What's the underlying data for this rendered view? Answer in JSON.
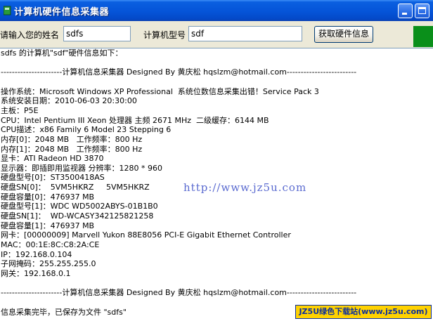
{
  "window": {
    "title": "计算机硬件信息采集器"
  },
  "form": {
    "name_label": "请输入您的姓名",
    "name_value": "sdfs",
    "pc_label": "计算机型号",
    "pc_value": "sdf",
    "get_button": "获取硬件信息"
  },
  "output": {
    "lines": [
      "sdfs 的计算机\"sdf\"硬件信息如下：",
      "",
      "----------------------计算机信息采集器 Designed By 黄庆松 hqslzm@hotmail.com-------------------------",
      "",
      "操作系统：Microsoft Windows XP Professional  系统位数信息采集出错！Service Pack 3",
      "系统安装日期：2010-06-03 20:30:00",
      "主板：P5E",
      "CPU：Intel Pentium III Xeon 处理器 主频 2671 MHz  二级缓存：6144 MB",
      "CPU描述：x86 Family 6 Model 23 Stepping 6",
      "内存[0]：2048 MB   工作频率：800 Hz",
      "内存[1]：2048 MB   工作频率：800 Hz",
      "显卡：ATI Radeon HD 3870",
      "显示器：即插即用监视器 分辨率：1280 * 960",
      "硬盘型号[0]：ST3500418AS",
      "硬盘SN[0]：  5VM5HKRZ     5VM5HKRZ",
      "硬盘容量[0]：476937 MB",
      "硬盘型号[1]：WDC WD5002ABYS-01B1B0",
      "硬盘SN[1]：  WD-WCASY342125821258",
      "硬盘容量[1]：476937 MB",
      "网卡：[00000009] Marvell Yukon 88E8056 PCI-E Gigabit Ethernet Controller",
      "MAC：00:1E:8C:C8:2A:CE",
      "IP：192.168.0.104",
      "子网掩码：255.255.255.0",
      "网关：192.168.0.1",
      "",
      "----------------------计算机信息采集器 Designed By 黄庆松 hqslzm@hotmail.com-------------------------",
      "",
      "信息采集完毕，已保存为文件 \"sdfs\""
    ],
    "watermark": "http://www.jz5u.com"
  },
  "badge": {
    "text": "JZ5U绿色下载站(www.jz5u.com)"
  }
}
